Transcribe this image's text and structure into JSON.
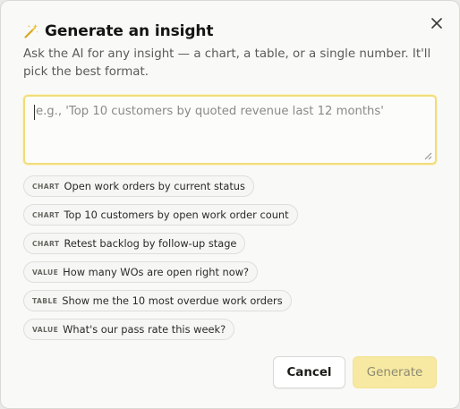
{
  "dialog": {
    "title": "Generate an insight",
    "subtitle": "Ask the AI for any insight — a chart, a table, or a single number. It'll pick the best format.",
    "prompt": {
      "value": "",
      "placeholder": "e.g., 'Top 10 customers by quoted revenue last 12 months'"
    },
    "suggestions": [
      {
        "tag": "CHART",
        "text": "Open work orders by current status"
      },
      {
        "tag": "CHART",
        "text": "Top 10 customers by open work order count"
      },
      {
        "tag": "CHART",
        "text": "Retest backlog by follow-up stage"
      },
      {
        "tag": "VALUE",
        "text": "How many WOs are open right now?"
      },
      {
        "tag": "TABLE",
        "text": "Show me the 10 most overdue work orders"
      },
      {
        "tag": "VALUE",
        "text": "What's our pass rate this week?"
      }
    ],
    "buttons": {
      "cancel": "Cancel",
      "generate": "Generate"
    },
    "icons": {
      "title": "magic-wand-icon",
      "close": "close-icon"
    },
    "colors": {
      "accent": "#f1dd7a",
      "generate_disabled": "#f7e9a1"
    }
  }
}
